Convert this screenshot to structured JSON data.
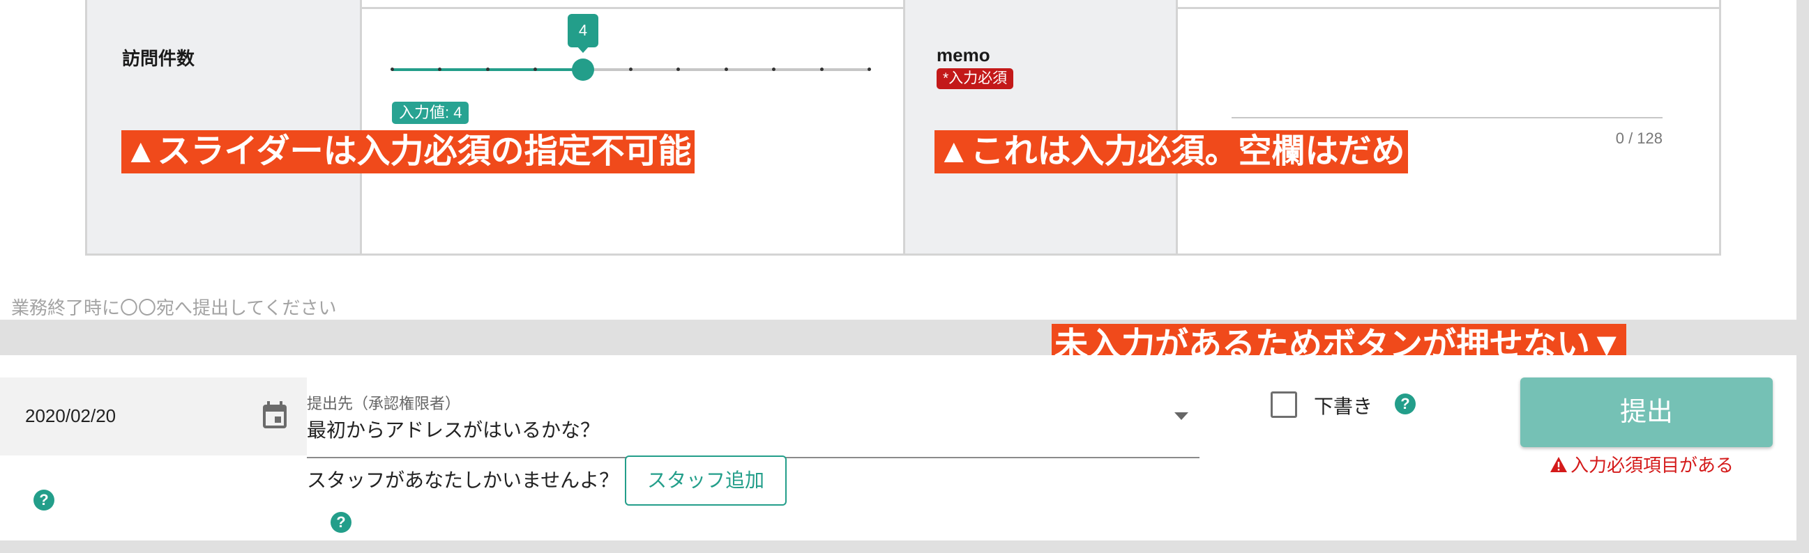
{
  "colors": {
    "accent": "#239e8a",
    "required": "#c31919",
    "annotation": "#f04a1b",
    "submit_disabled": "#75c1b5",
    "error": "#d41a1a"
  },
  "form": {
    "visits_label": "訪問件数",
    "slider": {
      "value": 4,
      "min": 0,
      "max": 10,
      "tooltip": "4",
      "chip": "入力値: 4"
    },
    "memo": {
      "label": "memo",
      "required_badge": "*入力必須",
      "counter": "0 / 128",
      "value": ""
    }
  },
  "annotations": {
    "slider_note": "▲スライダーは入力必須の指定不可能",
    "memo_note": "▲これは入力必須。空欄はだめ",
    "submit_note": "未入力があるためボタンが押せない▼"
  },
  "footer_note": "業務終了時に〇〇宛へ提出してください",
  "bottom": {
    "date": "2020/02/20",
    "calendar_icon": "calendar-icon",
    "recipient": {
      "label": "提出先（承認権限者）",
      "value": "最初からアドレスがはいるかな？"
    },
    "staff": {
      "text": "スタッフがあなたしかいませんよ？",
      "add_button": "スタッフ追加"
    },
    "draft": {
      "label": "下書き",
      "checked": false
    },
    "help_glyph": "?",
    "submit": {
      "label": "提出",
      "disabled": true
    },
    "error": "入力必須項目がある"
  }
}
